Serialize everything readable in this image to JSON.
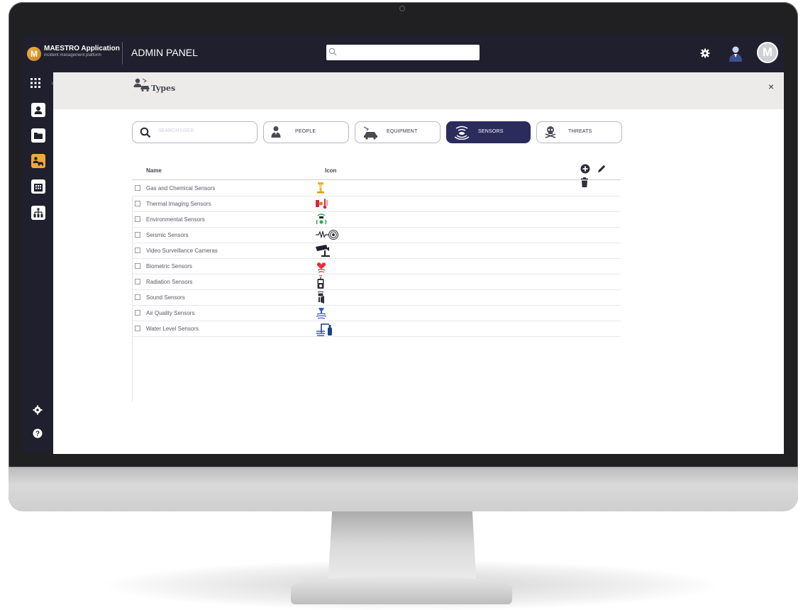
{
  "app": {
    "name": "MAESTRO Application",
    "subtitle": "incident management platform",
    "logo_letter": "M",
    "panel_title": "ADMIN PANEL",
    "avatar_letter": "M"
  },
  "top_search": {
    "placeholder": "",
    "value": ""
  },
  "sidebar": {
    "items": [
      {
        "icon": "apps-grid-icon"
      },
      {
        "icon": "user-card-icon"
      },
      {
        "icon": "folder-icon"
      },
      {
        "icon": "types-icon",
        "active": true
      },
      {
        "icon": "building-icon"
      },
      {
        "icon": "org-chart-icon"
      },
      {
        "icon": "gear-icon"
      },
      {
        "icon": "help-icon"
      }
    ]
  },
  "page": {
    "title": "Types",
    "close": "×"
  },
  "filters": {
    "search_placeholder": "SEARCH USER",
    "tabs": [
      {
        "label": "PEOPLE",
        "icon": "person-icon",
        "active": false
      },
      {
        "label": "EQUIPMENT",
        "icon": "equipment-icon",
        "active": false
      },
      {
        "label": "SENSORS",
        "icon": "sensor-icon",
        "active": true
      },
      {
        "label": "THREATS",
        "icon": "skull-icon",
        "active": false
      }
    ]
  },
  "table": {
    "columns": [
      "Name",
      "Icon"
    ],
    "actions": [
      "add-icon",
      "edit-icon",
      "delete-icon"
    ],
    "rows": [
      {
        "name": "Gas and Chemical Sensors",
        "icon": "gas-sensor-icon",
        "checked": false
      },
      {
        "name": "Thermal Imaging Sensors",
        "icon": "thermal-sensor-icon",
        "checked": false
      },
      {
        "name": "Environmental Sensors",
        "icon": "environmental-sensor-icon",
        "checked": false
      },
      {
        "name": "Seismic Sensors",
        "icon": "seismic-sensor-icon",
        "checked": false
      },
      {
        "name": "Video Surveillance Cameras",
        "icon": "camera-icon",
        "checked": false
      },
      {
        "name": "Biometric Sensors",
        "icon": "biometric-sensor-icon",
        "checked": false
      },
      {
        "name": "Radiation Sensors",
        "icon": "radiation-sensor-icon",
        "checked": false
      },
      {
        "name": "Sound Sensors",
        "icon": "sound-sensor-icon",
        "checked": false
      },
      {
        "name": "Air Quality Sensors",
        "icon": "air-quality-sensor-icon",
        "checked": false
      },
      {
        "name": "Water Level Sensors",
        "icon": "water-level-sensor-icon",
        "checked": false
      }
    ]
  },
  "colors": {
    "topbar": "#1f1f2e",
    "accent_active_tab": "#2b2b5c",
    "sidebar_active": "#f0a83a",
    "subheader": "#ecebe9"
  }
}
